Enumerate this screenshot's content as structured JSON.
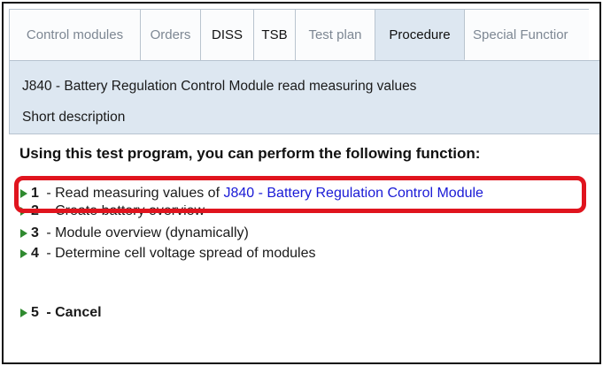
{
  "tabs": [
    {
      "label": "Control modules"
    },
    {
      "label": "Orders"
    },
    {
      "label": "DISS"
    },
    {
      "label": "TSB"
    },
    {
      "label": "Test plan"
    },
    {
      "label": "Procedure"
    },
    {
      "label": "Special Functior"
    }
  ],
  "header": {
    "title": "J840 - Battery Regulation Control Module  read measuring values",
    "subtitle": "Short description"
  },
  "intro": "Using this test program, you can perform the following function:",
  "steps": [
    {
      "num": "1",
      "sep": " - ",
      "text": "Read measuring values of ",
      "link": "J840 - Battery Regulation Control Module"
    },
    {
      "num": "2",
      "sep": " - ",
      "text": "Create battery overview"
    },
    {
      "num": "3",
      "sep": " - ",
      "text": "Module overview (dynamically)"
    },
    {
      "num": "4",
      "sep": " - ",
      "text": "Determine cell voltage spread of modules"
    },
    {
      "num": "5",
      "sep": " - ",
      "text": "Cancel"
    }
  ],
  "colors": {
    "tab_active_bg": "#dde7f1",
    "link": "#1a1ad6",
    "step_marker": "#2f8a2f",
    "highlight": "#e0141e"
  },
  "icons": {
    "step_marker": "play-triangle-icon"
  }
}
